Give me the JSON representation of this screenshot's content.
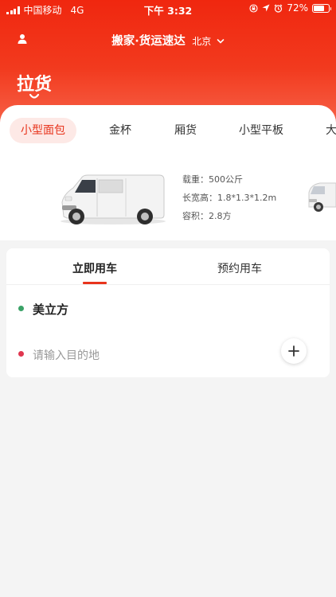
{
  "status_bar": {
    "carrier": "中国移动",
    "network": "4G",
    "time": "下午 3:32",
    "battery_percent": "72%",
    "battery_level": 0.72
  },
  "nav": {
    "brand": "搬家·货运速达",
    "city": "北京"
  },
  "main_tab": "拉货",
  "vehicle_tabs": [
    "小型面包",
    "金杯",
    "厢货",
    "小型平板",
    "大"
  ],
  "vehicle_tab_active": 0,
  "vehicle_specs": {
    "weight": "载重：500公斤",
    "dimensions": "长宽高：1.8*1.3*1.2m",
    "volume": "容积：2.8方"
  },
  "order_tabs": [
    "立即用车",
    "预约用车"
  ],
  "addresses": {
    "from": "美立方",
    "to_placeholder": "请输入目的地"
  },
  "colors": {
    "brand_red": "#f0270f",
    "from_dot": "#3aa267",
    "to_dot": "#e0364f"
  },
  "icons": [
    "user-icon",
    "chevron-down-icon",
    "plus-icon",
    "signal-icon",
    "battery-icon",
    "location-arrow-icon",
    "alarm-icon",
    "lock-rotation-icon"
  ]
}
